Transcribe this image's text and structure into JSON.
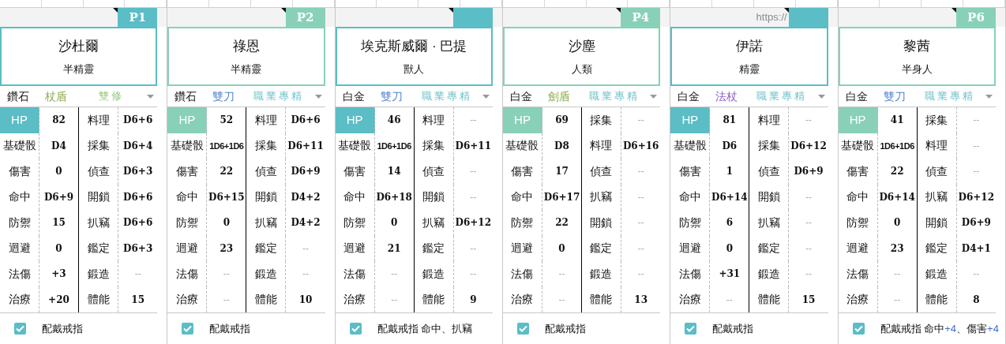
{
  "cards": [
    {
      "badge": "P1",
      "color": "#5bbdc5",
      "name": "沙杜爾",
      "race": "半精靈",
      "material": "鑽石",
      "weapon": {
        "text": "杖盾",
        "color": "#8aae4c"
      },
      "class": {
        "text": "雙修",
        "color": "#93c97a"
      },
      "hp_label": "HP",
      "hp": "82",
      "left": [
        {
          "label": "基礎骰",
          "value": "D4",
          "kind": "value"
        },
        {
          "label": "傷害",
          "value": "0",
          "kind": "value"
        },
        {
          "label": "命中",
          "value": "D6+9",
          "kind": "value"
        },
        {
          "label": "防禦",
          "value": "15",
          "kind": "value"
        },
        {
          "label": "迴避",
          "value": "0",
          "kind": "value"
        },
        {
          "label": "法傷",
          "value": "+3",
          "kind": "value"
        },
        {
          "label": "治療",
          "value": "+20",
          "kind": "value"
        }
      ],
      "right": [
        {
          "label": "料理",
          "value": "D6+6",
          "kind": "value"
        },
        {
          "label": "採集",
          "value": "D6+4",
          "kind": "value"
        },
        {
          "label": "偵查",
          "value": "D6+3",
          "kind": "value"
        },
        {
          "label": "開鎖",
          "value": "D6+6",
          "kind": "value"
        },
        {
          "label": "扒竊",
          "value": "D6+6",
          "kind": "value"
        },
        {
          "label": "鑑定",
          "value": "D6+3",
          "kind": "value"
        },
        {
          "label": "鍛造",
          "value": "--",
          "kind": "none"
        },
        {
          "label": "體能",
          "value": "15",
          "kind": "value"
        }
      ],
      "ring": {
        "checked": true,
        "label": "配戴戒指"
      }
    },
    {
      "badge": "P2",
      "color": "#88d1b8",
      "name": "祿恩",
      "race": "半精靈",
      "material": "鑽石",
      "weapon": {
        "text": "雙刀",
        "color": "#4f7fd1"
      },
      "class": {
        "text": "職業專精",
        "color": "#70c2cb"
      },
      "hp_label": "HP",
      "hp": "52",
      "left": [
        {
          "label": "基礎骰",
          "value": "1D6+1D6",
          "kind": "value"
        },
        {
          "label": "傷害",
          "value": "22",
          "kind": "value"
        },
        {
          "label": "命中",
          "value": "D6+15",
          "kind": "value"
        },
        {
          "label": "防禦",
          "value": "0",
          "kind": "value"
        },
        {
          "label": "迴避",
          "value": "23",
          "kind": "value"
        },
        {
          "label": "法傷",
          "value": "--",
          "kind": "none"
        },
        {
          "label": "治療",
          "value": "--",
          "kind": "none"
        }
      ],
      "right": [
        {
          "label": "料理",
          "value": "D6+6",
          "kind": "value"
        },
        {
          "label": "採集",
          "value": "D6+11",
          "kind": "value"
        },
        {
          "label": "偵查",
          "value": "D6+9",
          "kind": "value"
        },
        {
          "label": "開鎖",
          "value": "D4+2",
          "kind": "value"
        },
        {
          "label": "扒竊",
          "value": "D4+2",
          "kind": "value"
        },
        {
          "label": "鑑定",
          "value": "--",
          "kind": "none"
        },
        {
          "label": "鍛造",
          "value": "--",
          "kind": "none"
        },
        {
          "label": "體能",
          "value": "10",
          "kind": "value"
        }
      ],
      "ring": {
        "checked": true,
        "label": "配戴戒指"
      }
    },
    {
      "color": "#5bbdc5",
      "name": "埃克斯威爾 · 巴提",
      "race": "獸人",
      "material": "白金",
      "weapon": {
        "text": "雙刀",
        "color": "#4f7fd1"
      },
      "class": {
        "text": "職業專精",
        "color": "#70c2cb"
      },
      "hp_label": "HP",
      "hp": "46",
      "left": [
        {
          "label": "基礎骰",
          "value": "1D6+1D6",
          "kind": "value"
        },
        {
          "label": "傷害",
          "value": "14",
          "kind": "value"
        },
        {
          "label": "命中",
          "value": "D6+18",
          "kind": "value"
        },
        {
          "label": "防禦",
          "value": "0",
          "kind": "value"
        },
        {
          "label": "迴避",
          "value": "21",
          "kind": "value"
        },
        {
          "label": "法傷",
          "value": "--",
          "kind": "none"
        },
        {
          "label": "治療",
          "value": "--",
          "kind": "none"
        }
      ],
      "right": [
        {
          "label": "料理",
          "value": "--",
          "kind": "none"
        },
        {
          "label": "採集",
          "value": "D6+11",
          "kind": "value"
        },
        {
          "label": "偵查",
          "value": "--",
          "kind": "none"
        },
        {
          "label": "開鎖",
          "value": "--",
          "kind": "none"
        },
        {
          "label": "扒竊",
          "value": "D6+12",
          "kind": "value"
        },
        {
          "label": "鑑定",
          "value": "--",
          "kind": "none"
        },
        {
          "label": "鍛造",
          "value": "--",
          "kind": "none"
        },
        {
          "label": "體能",
          "value": "9",
          "kind": "value"
        }
      ],
      "ring": {
        "checked": true,
        "label": "配戴戒指",
        "effect": [
          {
            "text": "命中、扒竊",
            "kind": "plain"
          }
        ]
      }
    },
    {
      "badge": "P4",
      "color": "#88d1b8",
      "name": "沙塵",
      "race": "人類",
      "material": "白金",
      "weapon": {
        "text": "劍盾",
        "color": "#8aae4c"
      },
      "class": {
        "text": "職業專精",
        "color": "#70c2cb"
      },
      "hp_label": "HP",
      "hp": "69",
      "left": [
        {
          "label": "基礎骰",
          "value": "D8",
          "kind": "value"
        },
        {
          "label": "傷害",
          "value": "17",
          "kind": "value"
        },
        {
          "label": "命中",
          "value": "D6+17",
          "kind": "value"
        },
        {
          "label": "防禦",
          "value": "22",
          "kind": "value"
        },
        {
          "label": "迴避",
          "value": "0",
          "kind": "value"
        },
        {
          "label": "法傷",
          "value": "--",
          "kind": "none"
        },
        {
          "label": "治療",
          "value": "--",
          "kind": "none"
        }
      ],
      "right": [
        {
          "label": "採集",
          "value": "--",
          "kind": "none"
        },
        {
          "label": "料理",
          "value": "D6+16",
          "kind": "value"
        },
        {
          "label": "偵查",
          "value": "--",
          "kind": "none"
        },
        {
          "label": "扒竊",
          "value": "--",
          "kind": "none"
        },
        {
          "label": "開鎖",
          "value": "--",
          "kind": "none"
        },
        {
          "label": "鑑定",
          "value": "--",
          "kind": "none"
        },
        {
          "label": "鍛造",
          "value": "--",
          "kind": "none"
        },
        {
          "label": "體能",
          "value": "13",
          "kind": "value"
        }
      ],
      "ring": {
        "checked": true,
        "label": "配戴戒指"
      }
    },
    {
      "cell_note": "https://",
      "color": "#5bbdc5",
      "name": "伊諾",
      "race": "精靈",
      "material": "白金",
      "weapon": {
        "text": "法杖",
        "color": "#8a5cc4"
      },
      "class": {
        "text": "職業專精",
        "color": "#70c2cb"
      },
      "hp_label": "HP",
      "hp": "81",
      "left": [
        {
          "label": "基礎骰",
          "value": "D6",
          "kind": "value"
        },
        {
          "label": "傷害",
          "value": "1",
          "kind": "value"
        },
        {
          "label": "命中",
          "value": "D6+14",
          "kind": "value"
        },
        {
          "label": "防禦",
          "value": "6",
          "kind": "value"
        },
        {
          "label": "迴避",
          "value": "0",
          "kind": "value"
        },
        {
          "label": "法傷",
          "value": "+31",
          "kind": "value"
        },
        {
          "label": "治療",
          "value": "--",
          "kind": "none"
        }
      ],
      "right": [
        {
          "label": "料理",
          "value": "--",
          "kind": "none"
        },
        {
          "label": "採集",
          "value": "D6+12",
          "kind": "value"
        },
        {
          "label": "偵查",
          "value": "D6+9",
          "kind": "value"
        },
        {
          "label": "開鎖",
          "value": "--",
          "kind": "none"
        },
        {
          "label": "扒竊",
          "value": "--",
          "kind": "none"
        },
        {
          "label": "鑑定",
          "value": "--",
          "kind": "none"
        },
        {
          "label": "鍛造",
          "value": "--",
          "kind": "none"
        },
        {
          "label": "體能",
          "value": "15",
          "kind": "value"
        }
      ],
      "ring": {
        "checked": true,
        "label": "配戴戒指"
      }
    },
    {
      "badge": "P6",
      "color": "#88d1b8",
      "name": "黎茜",
      "race": "半身人",
      "material": "白金",
      "weapon": {
        "text": "雙刀",
        "color": "#4f7fd1"
      },
      "class": {
        "text": "職業專精",
        "color": "#70c2cb"
      },
      "hp_label": "HP",
      "hp": "41",
      "left": [
        {
          "label": "基礎骰",
          "value": "1D6+1D6",
          "kind": "value"
        },
        {
          "label": "傷害",
          "value": "22",
          "kind": "value"
        },
        {
          "label": "命中",
          "value": "D6+14",
          "kind": "value"
        },
        {
          "label": "防禦",
          "value": "0",
          "kind": "value"
        },
        {
          "label": "迴避",
          "value": "23",
          "kind": "value"
        },
        {
          "label": "法傷",
          "value": "--",
          "kind": "none"
        },
        {
          "label": "治療",
          "value": "--",
          "kind": "none"
        }
      ],
      "right": [
        {
          "label": "採集",
          "value": "--",
          "kind": "none"
        },
        {
          "label": "料理",
          "value": "--",
          "kind": "none"
        },
        {
          "label": "偵查",
          "value": "--",
          "kind": "none"
        },
        {
          "label": "扒竊",
          "value": "D6+12",
          "kind": "value"
        },
        {
          "label": "開鎖",
          "value": "D6+9",
          "kind": "value"
        },
        {
          "label": "鑑定",
          "value": "D4+1",
          "kind": "value"
        },
        {
          "label": "鍛造",
          "value": "--",
          "kind": "none"
        },
        {
          "label": "體能",
          "value": "8",
          "kind": "value"
        }
      ],
      "ring": {
        "checked": true,
        "label": "配戴戒指",
        "effect": [
          {
            "text": "命中",
            "kind": "plain"
          },
          {
            "text": "+4",
            "kind": "bonus"
          },
          {
            "text": "、傷害",
            "kind": "plain"
          },
          {
            "text": "+4",
            "kind": "bonus"
          }
        ]
      }
    }
  ]
}
